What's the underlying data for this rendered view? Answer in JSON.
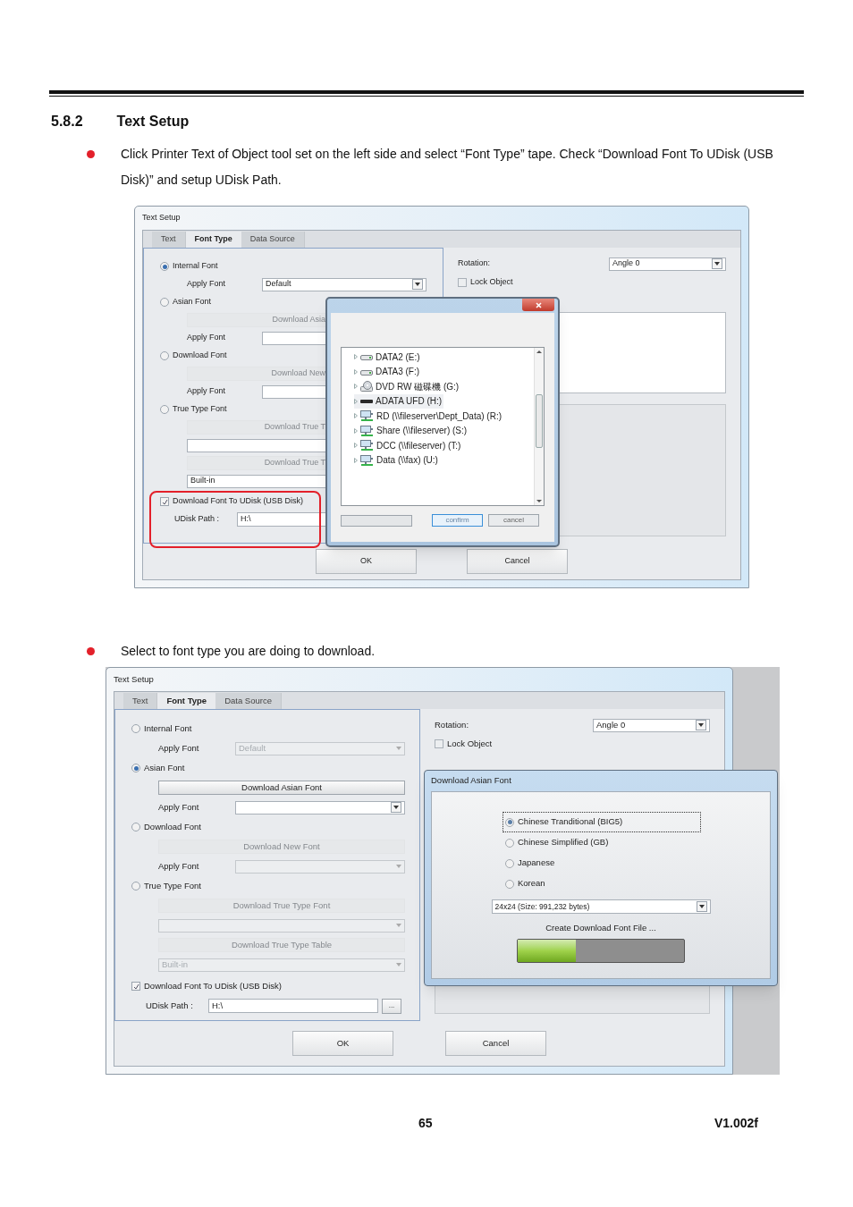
{
  "section": {
    "number": "5.8.2",
    "title": "Text Setup"
  },
  "blocks": [
    {
      "kind": "bullet",
      "text": "Click Printer Text of Object tool set on the left side and select “Font Type” tape. Check “Download Font To UDisk (USB Disk)” and setup UDisk Path."
    },
    {
      "kind": "figure",
      "window": {
        "title": "Text Setup",
        "tabs": [
          {
            "label": "Text",
            "selected": false
          },
          {
            "label": "Font Type",
            "selected": true
          },
          {
            "label": "Data Source",
            "selected": false
          }
        ],
        "font_rows": [
          {
            "kind": "radio",
            "label": "Internal Font",
            "selected": true
          },
          {
            "kind": "select",
            "label": "Apply Font",
            "value": "Default",
            "disabled": false
          },
          {
            "kind": "radio",
            "label": "Asian Font",
            "selected": false
          },
          {
            "kind": "button",
            "label": "Download Asia",
            "disabled": true
          },
          {
            "kind": "field",
            "label": "Apply Font"
          },
          {
            "kind": "radio",
            "label": "Download Font",
            "selected": false
          },
          {
            "kind": "button",
            "label": "Download New",
            "disabled": true
          },
          {
            "kind": "field",
            "label": "Apply Font"
          },
          {
            "kind": "radio",
            "label": "True Type Font",
            "selected": false
          },
          {
            "kind": "button",
            "label": "Download True T",
            "disabled": true
          },
          {
            "kind": "field"
          },
          {
            "kind": "button",
            "label": "Download True T",
            "disabled": true
          },
          {
            "kind": "field",
            "value": "Built-in"
          },
          {
            "kind": "checkbox",
            "label": "Download Font To UDisk (USB Disk)",
            "checked": true,
            "highlighted": true
          },
          {
            "kind": "path",
            "label": "UDisk Path :",
            "value": "H:\\"
          }
        ],
        "rotation": {
          "label": "Rotation:",
          "value": "Angle 0"
        },
        "lock_object": {
          "label": "Lock Object",
          "checked": false
        },
        "buttons": [
          "OK",
          "Cancel"
        ]
      },
      "folder_dialog": {
        "tree": [
          {
            "label": "DATA2 (E:)",
            "kind": "drive",
            "selected": false
          },
          {
            "label": "DATA3 (F:)",
            "kind": "drive",
            "selected": false
          },
          {
            "label": "DVD RW 磁碟機 (G:)",
            "kind": "dvd",
            "selected": false
          },
          {
            "label": "ADATA UFD (H:)",
            "kind": "usb",
            "selected": true
          },
          {
            "label": "RD (\\\\fileserver\\Dept_Data) (R:)",
            "kind": "network",
            "selected": false
          },
          {
            "label": "Share (\\\\fileserver) (S:)",
            "kind": "network",
            "selected": false
          },
          {
            "label": "DCC (\\\\fileserver) (T:)",
            "kind": "network",
            "selected": false
          },
          {
            "label": "Data (\\\\fax) (U:)",
            "kind": "network",
            "selected": false
          }
        ],
        "buttons": [
          "confirm",
          "cancel"
        ]
      }
    },
    {
      "kind": "bullet",
      "text": "Select to font type you are doing to download."
    },
    {
      "kind": "figure",
      "window": {
        "title": "Text Setup",
        "tabs": [
          {
            "label": "Text",
            "selected": false
          },
          {
            "label": "Font Type",
            "selected": true
          },
          {
            "label": "Data Source",
            "selected": false
          }
        ],
        "font_rows": [
          {
            "kind": "radio",
            "label": "Internal Font",
            "selected": false
          },
          {
            "kind": "select",
            "label": "Apply Font",
            "value": "Default",
            "disabled": true
          },
          {
            "kind": "radio",
            "label": "Asian Font",
            "selected": true
          },
          {
            "kind": "button",
            "label": "Download Asian Font",
            "disabled": false
          },
          {
            "kind": "select",
            "label": "Apply Font",
            "disabled": false
          },
          {
            "kind": "radio",
            "label": "Download Font",
            "selected": false
          },
          {
            "kind": "button",
            "label": "Download New Font",
            "disabled": true
          },
          {
            "kind": "select",
            "label": "Apply Font",
            "disabled": true
          },
          {
            "kind": "radio",
            "label": "True Type Font",
            "selected": false
          },
          {
            "kind": "button",
            "label": "Download True Type Font",
            "disabled": true
          },
          {
            "kind": "select",
            "disabled": true
          },
          {
            "kind": "button",
            "label": "Download True Type Table",
            "disabled": true
          },
          {
            "kind": "select",
            "value": "Built-in",
            "disabled": true
          },
          {
            "kind": "checkbox",
            "label": "Download Font To UDisk (USB Disk)",
            "checked": true,
            "highlighted": false
          },
          {
            "kind": "path",
            "label": "UDisk Path :",
            "value": "H:\\",
            "browse": "..."
          }
        ],
        "rotation": {
          "label": "Rotation:",
          "value": "Angle 0"
        },
        "lock_object": {
          "label": "Lock Object",
          "checked": false
        },
        "buttons": [
          "OK",
          "Cancel"
        ]
      },
      "asian_dialog": {
        "title": "Download Asian Font",
        "options": [
          {
            "label": "Chinese Tranditional (BIG5)",
            "selected": true
          },
          {
            "label": "Chinese Simplified (GB)",
            "selected": false
          },
          {
            "label": "Japanese",
            "selected": false
          },
          {
            "label": "Korean",
            "selected": false
          }
        ],
        "size": "24x24 (Size: 991,232 bytes)",
        "status": "Create Download Font File ...",
        "progress": {
          "level": 0.35
        }
      }
    }
  ],
  "footer": {
    "page_number": "65",
    "version": "V1.002f"
  }
}
